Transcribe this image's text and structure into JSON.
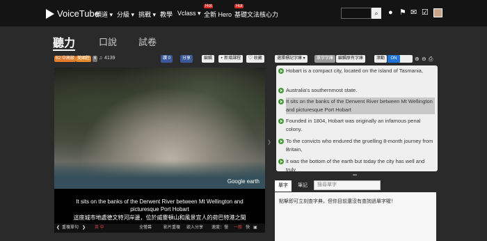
{
  "nav": {
    "logo": "VoiceTube",
    "items": [
      "頻道 ▾",
      "分級 ▾",
      "挑戰 ▾",
      "教學",
      "Vclass ▾",
      "全新 Hero",
      "基礎文法核心力"
    ],
    "hot_badge": "Hot",
    "search_placeholder": ""
  },
  "tabs": [
    "聽力",
    "口說",
    "試卷"
  ],
  "video_meta": {
    "level_badge": "B2 中高級",
    "accent_badge": "美國腔",
    "cc_badge": "6",
    "plays": "4139",
    "like_label": "讚 0",
    "share_label": "分享",
    "edit_label": "編輯",
    "add_course_label": "新增課程",
    "favorite_label": "收藏",
    "brand_colors": {
      "level": "#e07a2c",
      "accent": "#e08c2f",
      "like": "#3b5998",
      "toggle_on": "#1e74d9"
    }
  },
  "video": {
    "watermark": "Google earth",
    "subtitle_en": "It sits on the banks of the Derwent River between Mt Wellington and picturesque Port Hobart",
    "subtitle_zh": "這座城市地處德文特河岸邊，位於威靈頓山和風景宜人的荷巴特港之間"
  },
  "controls": {
    "prev": "重複單句",
    "lang": "英 中",
    "fullscreen": "全螢幕",
    "repeat": "影片重複",
    "embed": "嵌入分享",
    "speed_label": "速度：慢",
    "speed_normal": "一般",
    "speed_fast": "快"
  },
  "transcript_tools": {
    "select_label": "選擇標記字庫 ▾",
    "mark_on": "單字字庫",
    "mark_word": "編輯原有字庫",
    "scroll_label": "滾動",
    "toggle_on": "ON"
  },
  "transcript": [
    {
      "text": "Hobart is a compact city, located on the island of Tasmania,",
      "active": false
    },
    {
      "text": "Australia's southernmost state.",
      "active": false
    },
    {
      "text": "It sits on the banks of the Derwent River between Mt Wellington and picturesque Port Hobart",
      "active": true
    },
    {
      "text": "Founded in 1804, Hobart was originally an infamous penal colony.",
      "active": false
    },
    {
      "text": "To the convicts who endured the gruelling 8-month journey from Britain,",
      "active": false
    },
    {
      "text": "it was the bottom of the earth but today the city has well and truly",
      "active": false
    }
  ],
  "word_panel": {
    "tab_words": "單字",
    "tab_notes": "筆記",
    "search_placeholder": "搜尋單字",
    "hint": "點擊即可立刻查字典，但你目前還沒有查詢過單字喔！"
  },
  "icons": [
    "search-icon",
    "user-icon",
    "flag-icon",
    "mail-icon",
    "check-icon",
    "play-icon",
    "zoom-in-icon",
    "zoom-out-icon",
    "print-icon",
    "headphone-icon"
  ]
}
